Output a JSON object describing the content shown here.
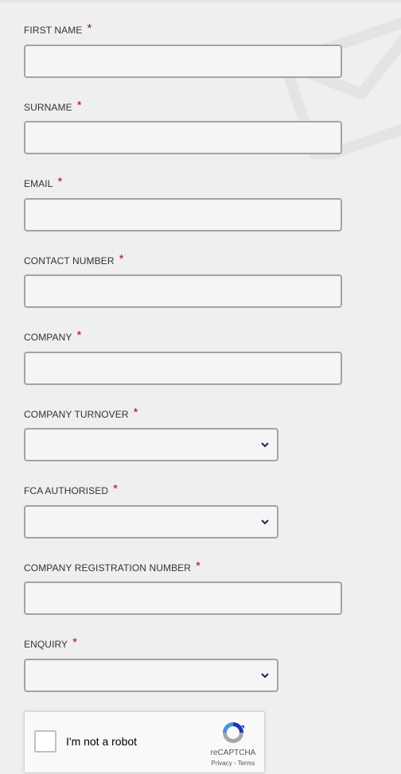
{
  "fields": [
    {
      "label": "FIRST NAME",
      "required_mark": "*",
      "type": "text",
      "value": ""
    },
    {
      "label": "SURNAME",
      "required_mark": "*",
      "type": "text",
      "value": ""
    },
    {
      "label": "EMAIL",
      "required_mark": "*",
      "type": "text",
      "value": ""
    },
    {
      "label": "CONTACT NUMBER",
      "required_mark": "*",
      "type": "text",
      "value": ""
    },
    {
      "label": "COMPANY",
      "required_mark": "*",
      "type": "text",
      "value": ""
    },
    {
      "label": "COMPANY TURNOVER",
      "required_mark": "*",
      "type": "select",
      "value": ""
    },
    {
      "label": "FCA AUTHORISED",
      "required_mark": "*",
      "type": "select",
      "value": ""
    },
    {
      "label": "COMPANY REGISTRATION NUMBER",
      "required_mark": "*",
      "type": "text",
      "value": ""
    },
    {
      "label": "ENQUIRY",
      "required_mark": "*",
      "type": "select",
      "value": ""
    }
  ],
  "recaptcha": {
    "checkbox_label": "I'm not a robot",
    "brand": "reCAPTCHA",
    "privacy": "Privacy",
    "separator": "-",
    "terms": "Terms"
  },
  "colors": {
    "background": "#efefef",
    "input_background": "#f5f5f5",
    "input_border": "#a3a3a3",
    "required_mark": "#a3121c",
    "chevron": "#3b1a4f"
  },
  "icons": {
    "background": "envelope-icon",
    "select": "chevron-down-icon",
    "captcha": "recaptcha-logo-icon"
  }
}
